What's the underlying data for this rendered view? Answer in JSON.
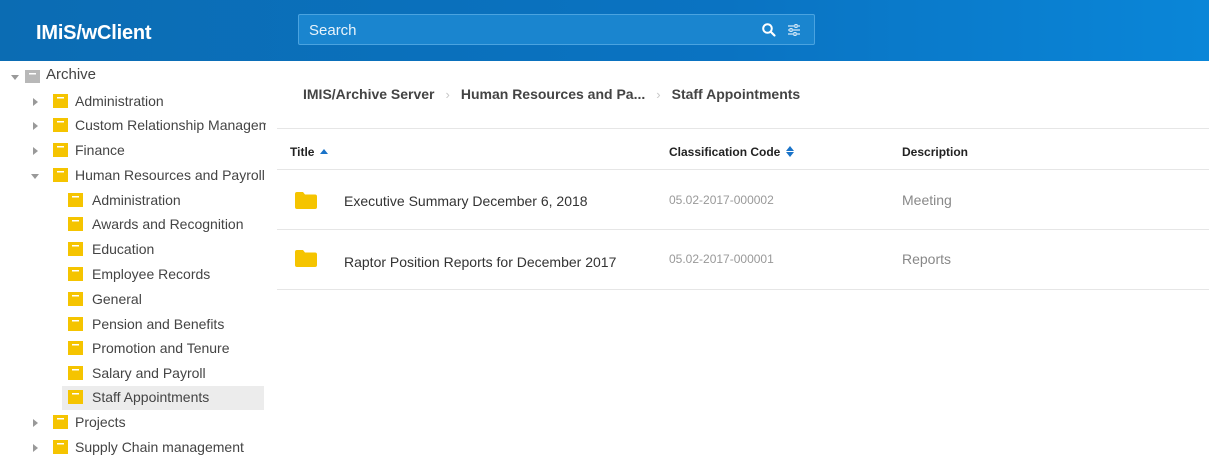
{
  "app": {
    "title": "IMiS/wClient"
  },
  "search": {
    "placeholder": "Search",
    "search_icon": "search-icon",
    "filter_icon": "filter-icon"
  },
  "sidebar": {
    "items": [
      {
        "label": "Archive",
        "level": 0,
        "expanded": true,
        "selected": false
      },
      {
        "label": "Administration",
        "level": 1,
        "expanded": false,
        "selected": false
      },
      {
        "label": "Custom Relationship Managem",
        "level": 1,
        "expanded": false,
        "selected": false
      },
      {
        "label": "Finance",
        "level": 1,
        "expanded": false,
        "selected": false
      },
      {
        "label": "Human Resources and Payroll",
        "level": 1,
        "expanded": true,
        "selected": false
      },
      {
        "label": "Administration",
        "level": 2,
        "selected": false
      },
      {
        "label": "Awards and Recognition",
        "level": 2,
        "selected": false
      },
      {
        "label": "Education",
        "level": 2,
        "selected": false
      },
      {
        "label": "Employee Records",
        "level": 2,
        "selected": false
      },
      {
        "label": "General",
        "level": 2,
        "selected": false
      },
      {
        "label": "Pension and Benefits",
        "level": 2,
        "selected": false
      },
      {
        "label": "Promotion and Tenure",
        "level": 2,
        "selected": false
      },
      {
        "label": "Salary and Payroll",
        "level": 2,
        "selected": false
      },
      {
        "label": "Staff Appointments",
        "level": 2,
        "selected": true
      },
      {
        "label": "Projects",
        "level": 1,
        "expanded": false,
        "selected": false
      },
      {
        "label": "Supply Chain management",
        "level": 1,
        "expanded": false,
        "selected": false
      }
    ]
  },
  "breadcrumb": [
    "IMIS/Archive Server",
    "Human Resources and Pa...",
    "Staff Appointments"
  ],
  "table": {
    "columns": {
      "title": "Title",
      "code": "Classification Code",
      "description": "Description"
    },
    "rows": [
      {
        "title": "Executive Summary December 6, 2018",
        "code": "05.02-2017-000002",
        "description": "Meeting"
      },
      {
        "title": "Raptor Position Reports for December 2017",
        "code": "05.02-2017-000001",
        "description": "Reports"
      }
    ]
  },
  "colors": {
    "header_bg": "#0b6cb3",
    "folder_yellow": "#f5c400",
    "archive_gray": "#b8b8b8",
    "selected_bg": "#ececec"
  }
}
